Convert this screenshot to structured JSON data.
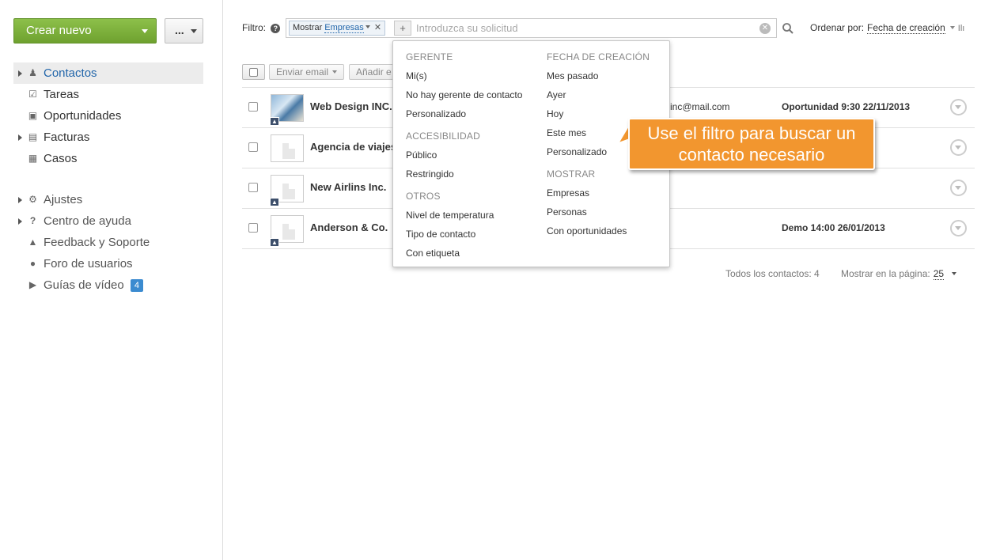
{
  "sidebar": {
    "create_label": "Crear nuevo",
    "more_label": "...",
    "items": [
      {
        "label": "Contactos"
      },
      {
        "label": "Tareas"
      },
      {
        "label": "Oportunidades"
      },
      {
        "label": "Facturas"
      },
      {
        "label": "Casos"
      }
    ],
    "sub_items": [
      {
        "label": "Ajustes"
      },
      {
        "label": "Centro de ayuda"
      },
      {
        "label": "Feedback y Soporte"
      },
      {
        "label": "Foro de usuarios"
      },
      {
        "label": "Guías de vídeo",
        "badge": "4"
      }
    ]
  },
  "filter": {
    "label": "Filtro:",
    "chip_key": "Mostrar",
    "chip_value": "Empresas",
    "placeholder": "Introduzca su solicitud"
  },
  "sort": {
    "label": "Ordenar por:",
    "value": "Fecha de creación"
  },
  "toolbar": {
    "send_email": "Enviar email",
    "add": "Añadir e"
  },
  "rows": [
    {
      "name": "Web Design INC.",
      "email": "inc@mail.com",
      "opportunity": "Oportunidad 9:30 22/11/2013"
    },
    {
      "name": "Agencia de viajes",
      "email": "",
      "opportunity": ""
    },
    {
      "name": "New Airlins Inc.",
      "email": "",
      "opportunity": ""
    },
    {
      "name": "Anderson & Co.",
      "email": "",
      "opportunity": "Demo 14:00 26/01/2013"
    }
  ],
  "footer": {
    "total": "Todos los contactos: 4",
    "per_page_label": "Mostrar en la página:",
    "per_page_value": "25"
  },
  "dropdown": {
    "col1": {
      "h1": "GERENTE",
      "g1": [
        "Mi(s)",
        "No hay gerente de contacto",
        "Personalizado"
      ],
      "h2": "ACCESIBILIDAD",
      "g2": [
        "Público",
        "Restringido"
      ],
      "h3": "OTROS",
      "g3": [
        "Nivel de temperatura",
        "Tipo de contacto",
        "Con etiqueta"
      ]
    },
    "col2": {
      "h1": "FECHA DE CREACIÓN",
      "g1": [
        "Mes pasado",
        "Ayer",
        "Hoy",
        "Este mes",
        "Personalizado"
      ],
      "h2": "MOSTRAR",
      "g2": [
        "Empresas",
        "Personas",
        "Con oportunidades"
      ]
    }
  },
  "callout": {
    "line1": "Use el filtro para buscar un",
    "line2": "contacto necesario"
  }
}
